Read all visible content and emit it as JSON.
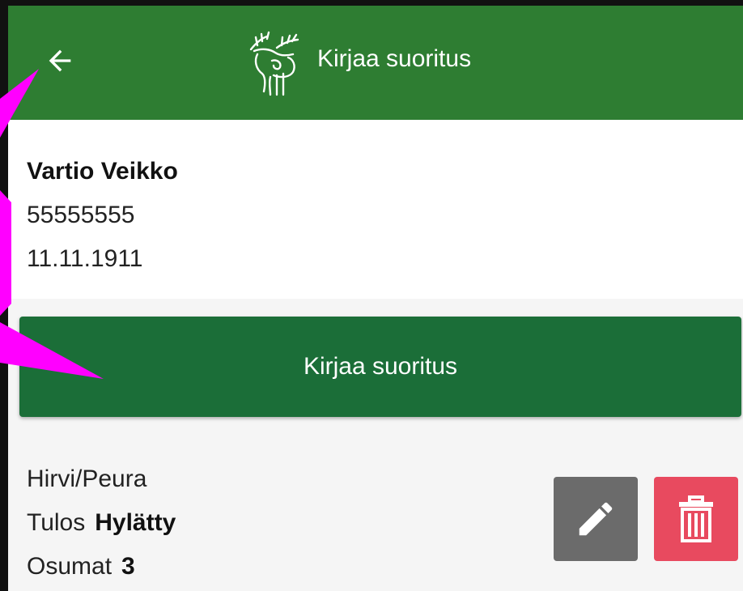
{
  "topbar": {
    "title": "Kirjaa suoritus",
    "back_icon": "arrow-left-icon",
    "logo_icon": "moose-logo-icon",
    "color": "#2e7d32"
  },
  "person": {
    "name": "Vartio Veikko",
    "id": "55555555",
    "date": "11.11.1911"
  },
  "record_button": {
    "label": "Kirjaa suoritus",
    "color": "#1b6e38"
  },
  "record": {
    "type": "Hirvi/Peura",
    "result_label": "Tulos",
    "result_value": "Hylätty",
    "hits_label": "Osumat",
    "hits_value": "3",
    "edit_icon": "pencil-icon",
    "delete_icon": "trash-icon",
    "edit_color": "#6b6b6b",
    "delete_color": "#e84a5f"
  },
  "annotation": {
    "color": "#ff00ff",
    "shape": "magenta-arrows-icon"
  }
}
